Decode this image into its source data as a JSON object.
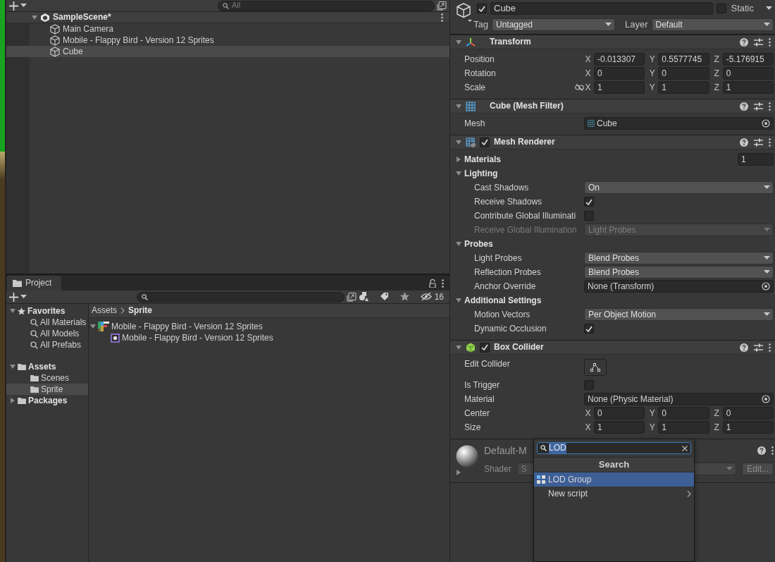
{
  "hierarchy": {
    "search": {
      "placeholder": "All"
    },
    "scene": {
      "name": "SampleScene*",
      "expanded": true
    },
    "objects": [
      {
        "name": "Main Camera",
        "selected": false
      },
      {
        "name": "Mobile - Flappy Bird - Version 12 Sprites",
        "selected": false
      },
      {
        "name": "Cube",
        "selected": true
      }
    ]
  },
  "project": {
    "tab": "Project",
    "hidden_count": "16",
    "tree": [
      {
        "label": "Favorites",
        "kind": "favorites",
        "expanded": true,
        "selected": false,
        "children": [
          {
            "label": "All Materials",
            "kind": "search",
            "selected": false
          },
          {
            "label": "All Models",
            "kind": "search",
            "selected": false
          },
          {
            "label": "All Prefabs",
            "kind": "search",
            "selected": false
          }
        ]
      },
      {
        "label": "Assets",
        "kind": "root",
        "expanded": true,
        "selected": false,
        "children": [
          {
            "label": "Scenes",
            "kind": "folder",
            "selected": false
          },
          {
            "label": "Sprite",
            "kind": "folder",
            "selected": true
          }
        ]
      },
      {
        "label": "Packages",
        "kind": "root",
        "expanded": false,
        "selected": false
      }
    ],
    "breadcrumb": [
      "Assets",
      "Sprite"
    ],
    "assets": [
      {
        "label": "Mobile - Flappy Bird - Version 12 Sprites",
        "kind": "texture",
        "expanded": true,
        "children": [
          {
            "label": "Mobile - Flappy Bird - Version 12 Sprites",
            "kind": "sprite"
          }
        ]
      }
    ]
  },
  "inspector": {
    "object": {
      "active": true,
      "name": "Cube",
      "static": false,
      "static_label": "Static",
      "tag_label": "Tag",
      "tag": "Untagged",
      "layer_label": "Layer",
      "layer": "Default"
    },
    "components": [
      {
        "kind": "transform",
        "title": "Transform",
        "expanded": true,
        "rows": [
          {
            "kind": "vector3",
            "label": "Position",
            "axes": [
              "X",
              "Y",
              "Z"
            ],
            "values": [
              "-0.013307",
              "0.5577745",
              "-5.176915"
            ]
          },
          {
            "kind": "vector3",
            "label": "Rotation",
            "axes": [
              "X",
              "Y",
              "Z"
            ],
            "values": [
              "0",
              "0",
              "0"
            ]
          },
          {
            "kind": "vector3",
            "label": "Scale",
            "axes": [
              "X",
              "Y",
              "Z"
            ],
            "values": [
              "1",
              "1",
              "1"
            ],
            "constrained": false
          }
        ]
      },
      {
        "kind": "mesh_filter",
        "title": "Cube (Mesh Filter)",
        "expanded": true,
        "rows": [
          {
            "kind": "mesh_object",
            "label": "Mesh",
            "value": "Cube"
          }
        ]
      },
      {
        "kind": "mesh_renderer",
        "title": "Mesh Renderer",
        "expanded": true,
        "enabled": true,
        "rows": [
          {
            "kind": "foldout",
            "label": "Materials",
            "expanded": false,
            "value": "1"
          },
          {
            "kind": "section",
            "label": "Lighting",
            "expanded": true,
            "children": [
              {
                "kind": "dropdown",
                "label": "Cast Shadows",
                "value": "On",
                "disabled": false
              },
              {
                "kind": "checkbox",
                "label": "Receive Shadows",
                "checked": true
              },
              {
                "kind": "checkbox",
                "label": "Contribute Global Illuminati",
                "checked": false
              },
              {
                "kind": "dropdown",
                "label": "Receive Global Illumination",
                "value": "Light Probes",
                "disabled": true
              }
            ]
          },
          {
            "kind": "section",
            "label": "Probes",
            "expanded": true,
            "children": [
              {
                "kind": "dropdown",
                "label": "Light Probes",
                "value": "Blend Probes",
                "disabled": false
              },
              {
                "kind": "dropdown",
                "label": "Reflection Probes",
                "value": "Blend Probes",
                "disabled": false
              },
              {
                "kind": "object",
                "label": "Anchor Override",
                "value": "None (Transform)"
              }
            ]
          },
          {
            "kind": "section",
            "label": "Additional Settings",
            "expanded": true,
            "children": [
              {
                "kind": "dropdown",
                "label": "Motion Vectors",
                "value": "Per Object Motion",
                "disabled": false
              },
              {
                "kind": "checkbox",
                "label": "Dynamic Occlusion",
                "checked": true
              }
            ]
          }
        ]
      },
      {
        "kind": "box_collider",
        "title": "Box Collider",
        "expanded": true,
        "enabled": true,
        "rows": [
          {
            "kind": "button",
            "label": "Edit Collider"
          },
          {
            "kind": "checkbox",
            "label": "Is Trigger",
            "checked": false
          },
          {
            "kind": "object",
            "label": "Material",
            "value": "None (Physic Material)"
          },
          {
            "kind": "vector3",
            "label": "Center",
            "axes": [
              "X",
              "Y",
              "Z"
            ],
            "values": [
              "0",
              "0",
              "0"
            ]
          },
          {
            "kind": "vector3",
            "label": "Size",
            "axes": [
              "X",
              "Y",
              "Z"
            ],
            "values": [
              "1",
              "1",
              "1"
            ]
          }
        ]
      },
      {
        "kind": "material",
        "title": "Default-M",
        "expanded": false,
        "shader_label": "Shader",
        "shader": "S",
        "edit_button": "Edit..."
      }
    ]
  },
  "add_component_menu": {
    "search": "LOD",
    "header": "Search",
    "items": [
      {
        "label": "LOD Group",
        "kind": "component",
        "selected": true
      },
      {
        "label": "New script",
        "kind": "submenu",
        "selected": false
      }
    ]
  }
}
